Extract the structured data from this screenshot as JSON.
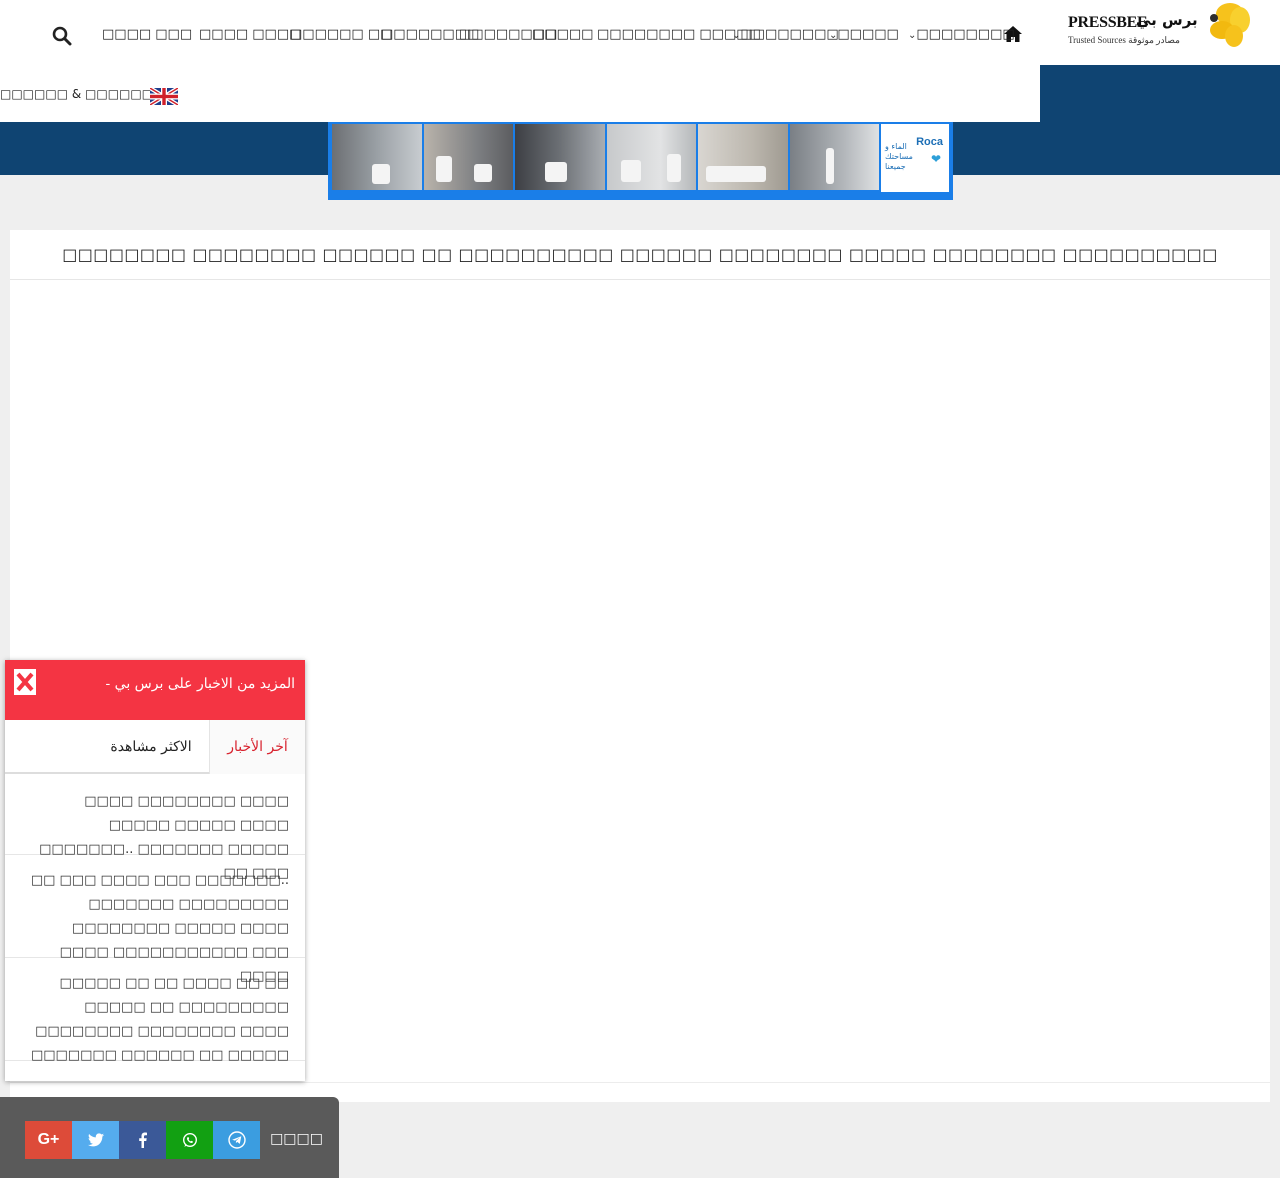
{
  "header": {
    "logo": {
      "name_en": "PRESSBEE",
      "name_ar": "برس بي",
      "tagline": "Trusted Sources مصادر موثوقة"
    },
    "nav": [
      {
        "label": "□□□□□□□□",
        "has_dropdown": true
      },
      {
        "label": "□□□□□",
        "has_dropdown": true
      },
      {
        "label": "□□□□□□□□",
        "has_dropdown": true
      },
      {
        "label": "□□□□□□□□ □□□□□"
      },
      {
        "label": "□□□□□"
      },
      {
        "label": "□□□□□□□□"
      },
      {
        "label": "□□□□□□□□"
      },
      {
        "label": "□□□□□□ □□"
      },
      {
        "label": "□□□□ □□□□"
      },
      {
        "label": "□□□□ □□□"
      }
    ],
    "row2": {
      "label": "□□□□□□ & □□□□□□□□"
    }
  },
  "banner": {
    "brand": "Roca",
    "brand_ar": "الماء و مساحتك جميعنا"
  },
  "article": {
    "title": "□□□□□□□□ □□□□□□□□ □□□□□□ □□ □□□□□□□□□□ □□□□□□ □□□□□□□□ □□□□□ □□□□□□□□ □□□□□□□□□□"
  },
  "popup": {
    "title": "- المزيد من الاخبار على برس بي",
    "tabs": [
      {
        "label": "آخر الأخبار"
      },
      {
        "label": "الاكثر مشاهدة"
      }
    ],
    "items": [
      {
        "text": "□□□□ □□□□□□□□ □□□□ □□□□□ □□□□□ □□□□ □□□□□□□.. □□□□□□□ □□□□□ □□ □□□"
      },
      {
        "text": "□□ □□□ □□□□ □□□ □□□□□□□.. □□□□□□□ □□□□□□□□□ □□□□□□□□ □□□□□ □□□□ □□□□ □□□□□□□□□□□ □□□ □□□□"
      },
      {
        "text": "□□□□□ □□ □□ □□□□ □□ □□ □□□□□ □□ □□□□□□□□□ □□□□□□□□ □□□□□□□□ □□□□ □□□□□□□ □□□□□□ □□ □□□□□"
      }
    ]
  },
  "share": {
    "label": "□□□□"
  },
  "colors": {
    "brand_blue": "#0f4472",
    "popup_red": "#f43443",
    "accent_red": "#d8232f"
  }
}
